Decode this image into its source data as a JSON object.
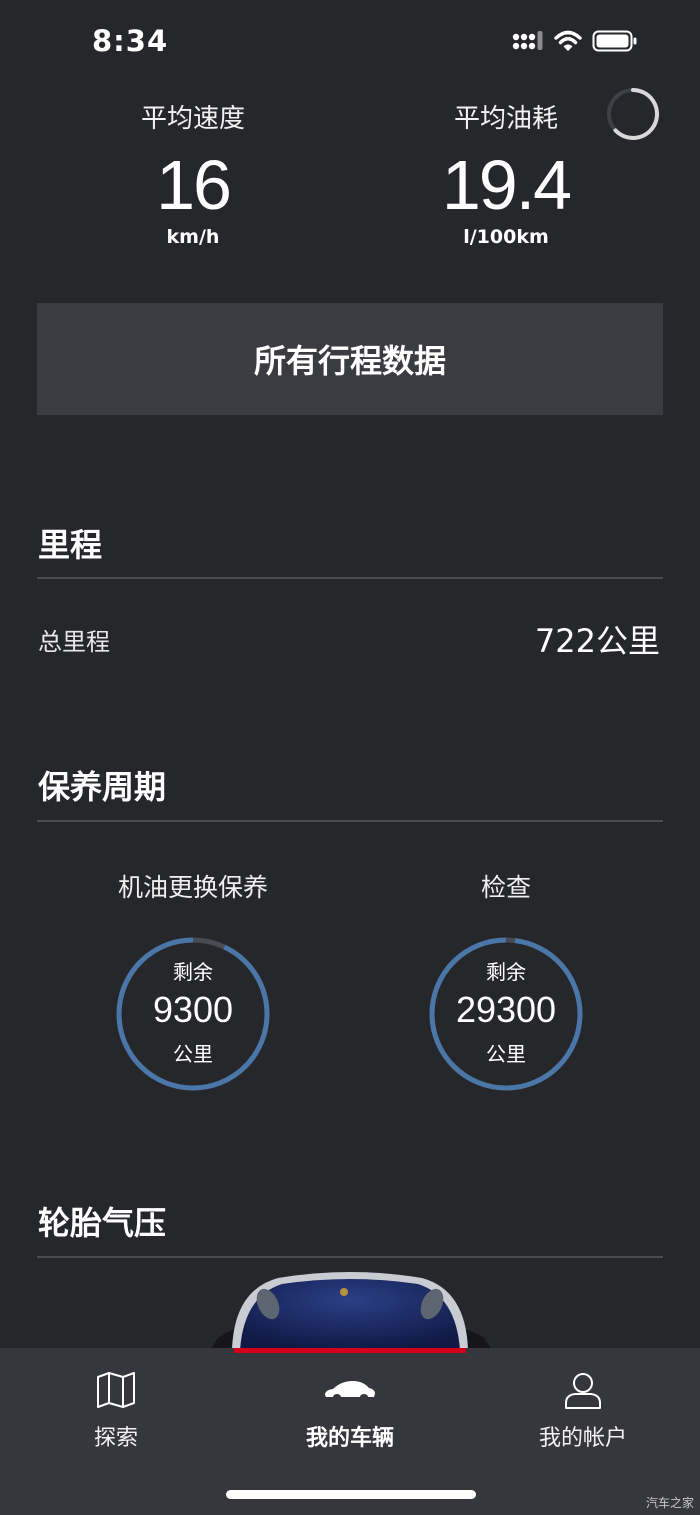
{
  "status_bar": {
    "time": "8:34"
  },
  "trip": {
    "avg_speed_label": "平均速度",
    "avg_speed_value": "16",
    "avg_speed_unit": "km/h",
    "avg_fuel_label": "平均油耗",
    "avg_fuel_value": "19.4",
    "avg_fuel_unit": "l/100km",
    "all_trips_button": "所有行程数据"
  },
  "mileage": {
    "title": "里程",
    "total_label": "总里程",
    "total_value": "722公里"
  },
  "service": {
    "title": "保养周期",
    "items": [
      {
        "title": "机油更换保养",
        "remaining_label": "剩余",
        "value": "9300",
        "unit": "公里",
        "progress": 0.93
      },
      {
        "title": "检查",
        "remaining_label": "剩余",
        "value": "29300",
        "unit": "公里",
        "progress": 0.98
      }
    ]
  },
  "tires": {
    "title": "轮胎气压"
  },
  "nav": {
    "items": [
      {
        "label": "探索",
        "icon": "map-icon"
      },
      {
        "label": "我的车辆",
        "icon": "car-icon"
      },
      {
        "label": "我的帐户",
        "icon": "user-icon"
      }
    ],
    "active_index": 1
  },
  "colors": {
    "accent": "#d5001c",
    "gauge": "#4a76a8",
    "background": "#26272b"
  },
  "watermark": "汽车之家"
}
